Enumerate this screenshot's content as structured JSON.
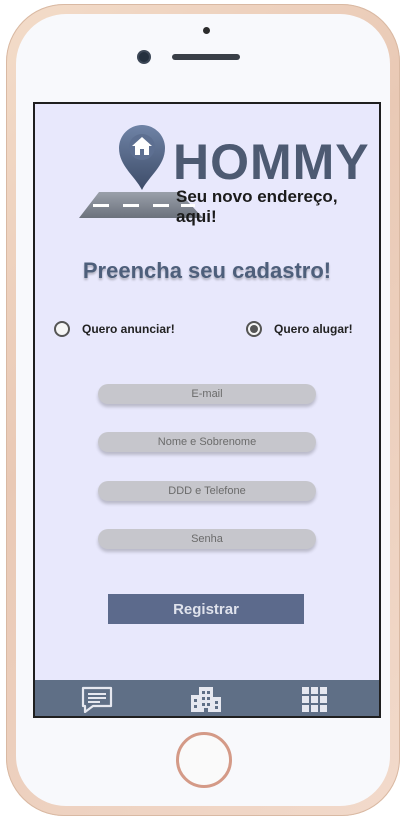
{
  "brand": {
    "name": "HOMMY",
    "tagline": "Seu novo endereço, aqui!",
    "accent_color": "#4d5a72"
  },
  "form": {
    "title": "Preencha seu cadastro!",
    "options": [
      {
        "label": "Quero anunciar!",
        "selected": false
      },
      {
        "label": "Quero alugar!",
        "selected": true
      }
    ],
    "fields": [
      {
        "placeholder": "E-mail",
        "value": ""
      },
      {
        "placeholder": "Nome e Sobrenome",
        "value": ""
      },
      {
        "placeholder": "DDD e Telefone",
        "value": ""
      },
      {
        "placeholder": "Senha",
        "value": ""
      }
    ],
    "submit_label": "Registrar"
  },
  "bottom_nav": {
    "items": [
      {
        "icon": "chat-icon"
      },
      {
        "icon": "building-icon"
      },
      {
        "icon": "grid-icon"
      }
    ],
    "background": "#5f6f86"
  }
}
